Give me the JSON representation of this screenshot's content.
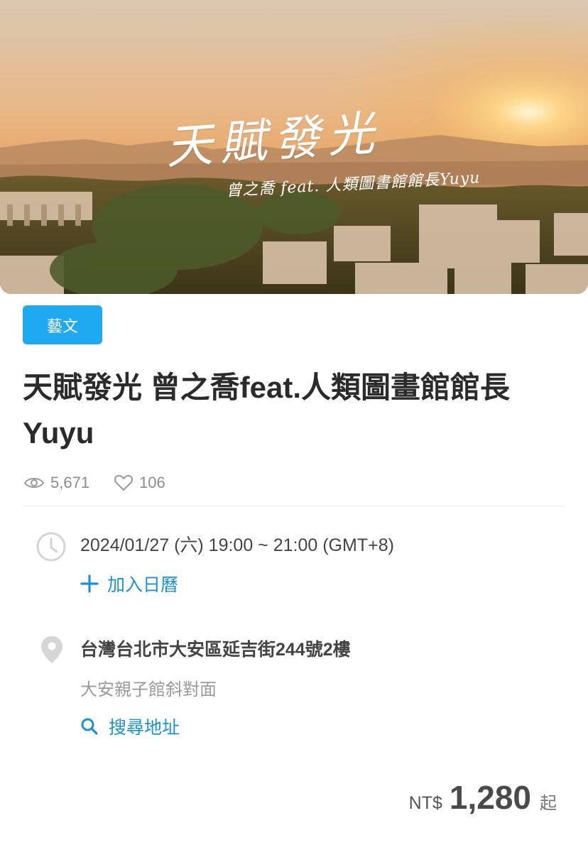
{
  "banner": {
    "title_art": "天賦發光",
    "subtitle_art": "曾之喬 feat. 人類圖書館館長Yuyu"
  },
  "event": {
    "category": "藝文",
    "title": "天賦發光 曾之喬feat.人類圖畫館館長Yuyu",
    "views": "5,671",
    "likes": "106"
  },
  "schedule": {
    "datetime": "2024/01/27 (六) 19:00 ~ 21:00 (GMT+8)",
    "add_calendar_label": "加入日曆"
  },
  "location": {
    "address": "台灣台北市大安區延吉街244號2樓",
    "note": "大安親子館斜對面",
    "search_label": "搜尋地址"
  },
  "price": {
    "currency": "NT$",
    "amount": "1,280",
    "suffix": "起"
  },
  "colors": {
    "accent": "#1a93d6",
    "badge": "#1fa9f0"
  }
}
